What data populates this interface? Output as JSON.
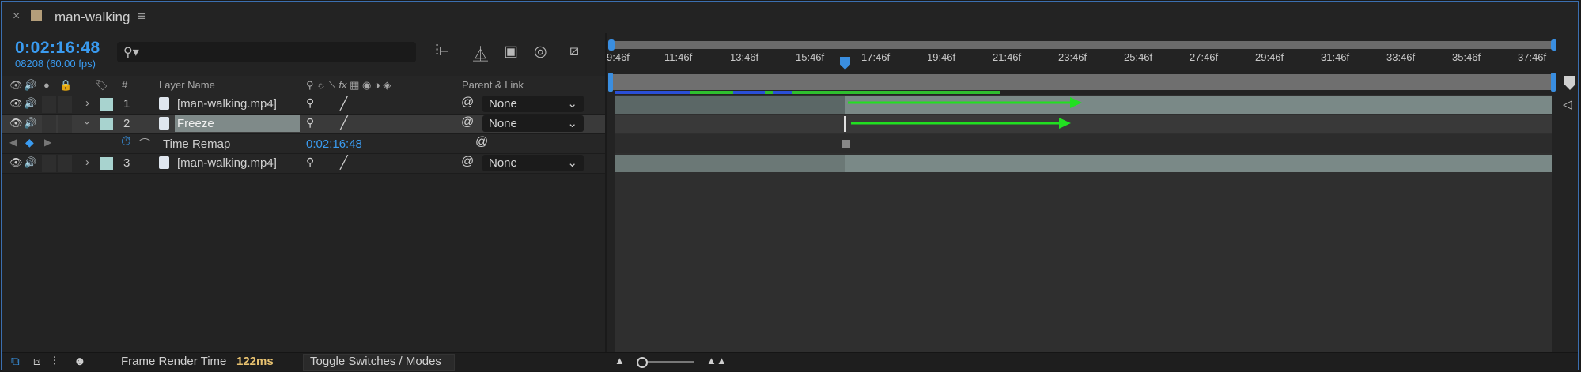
{
  "window": {
    "title": "man-walking"
  },
  "header": {
    "timecode": "0:02:16:48",
    "frame_info": "08208 (60.00 fps)",
    "search_placeholder": ""
  },
  "columns": {
    "number": "#",
    "layer_name": "Layer Name",
    "parent_link": "Parent & Link"
  },
  "layers": [
    {
      "number": "1",
      "name": "[man-walking.mp4]",
      "parent": "None"
    },
    {
      "number": "2",
      "name": "Freeze",
      "parent": "None"
    },
    {
      "number": "3",
      "name": "[man-walking.mp4]",
      "parent": "None"
    }
  ],
  "time_remap": {
    "label": "Time Remap",
    "value": "0:02:16:48"
  },
  "ruler": {
    "labels": [
      "9:46f",
      "11:46f",
      "13:46f",
      "15:46f",
      "17:46f",
      "19:46f",
      "21:46f",
      "23:46f",
      "25:46f",
      "27:46f",
      "29:46f",
      "31:46f",
      "33:46f",
      "35:46f",
      "37:46f"
    ]
  },
  "footer": {
    "frame_render_label": "Frame Render Time",
    "frame_render_value": "122ms",
    "toggle_label": "Toggle Switches / Modes"
  },
  "colors": {
    "accent": "#3a9bf0",
    "label_color": "#a8d3cf",
    "arrow": "#21e021",
    "render_bar_green": "#2fbf2f",
    "render_bar_blue": "#2a4fd6"
  }
}
